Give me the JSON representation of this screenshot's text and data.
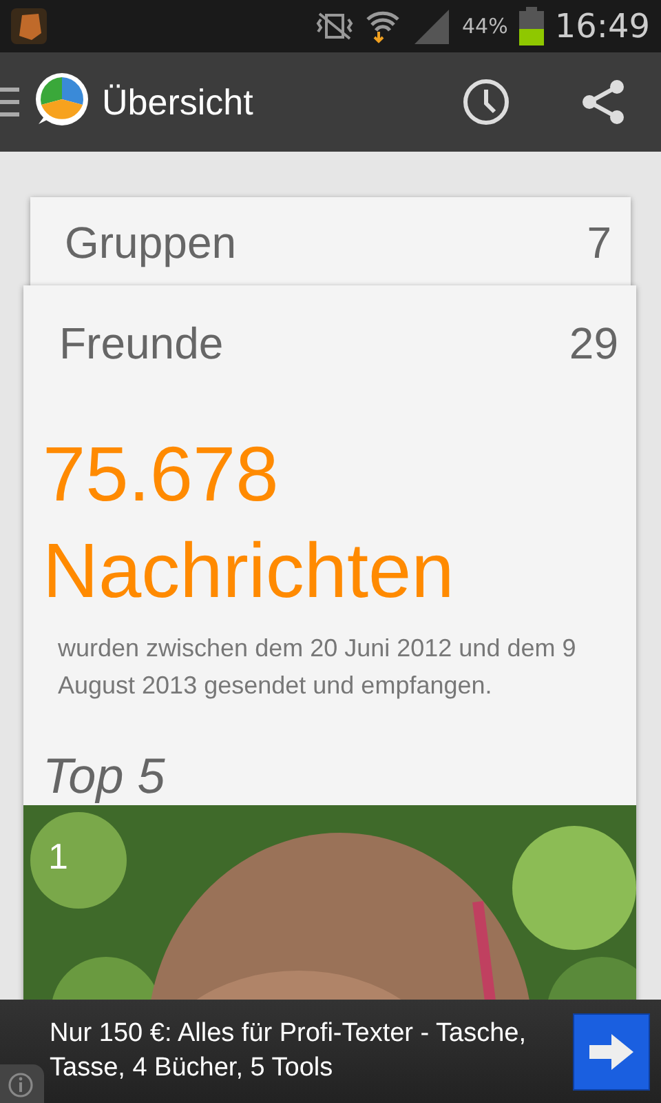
{
  "status_bar": {
    "battery": "44%",
    "time": "16:49"
  },
  "action_bar": {
    "title": "Übersicht"
  },
  "cards": [
    {
      "title": "Gruppen",
      "count": "7"
    },
    {
      "title": "Freunde",
      "count": "29",
      "big_number": "75.678",
      "big_label": "Nachrichten",
      "description": "wurden zwischen dem 20 Juni 2012 und dem 9 August 2013 gesendet und empfangen.",
      "section_title": "Top 5",
      "top_item": {
        "rank": "1",
        "kind": "picture"
      }
    }
  ],
  "ad": {
    "text": "Nur 150 €: Alles für Profi-Texter - Tasche, Tasse, 4 Bücher, 5 Tools"
  }
}
